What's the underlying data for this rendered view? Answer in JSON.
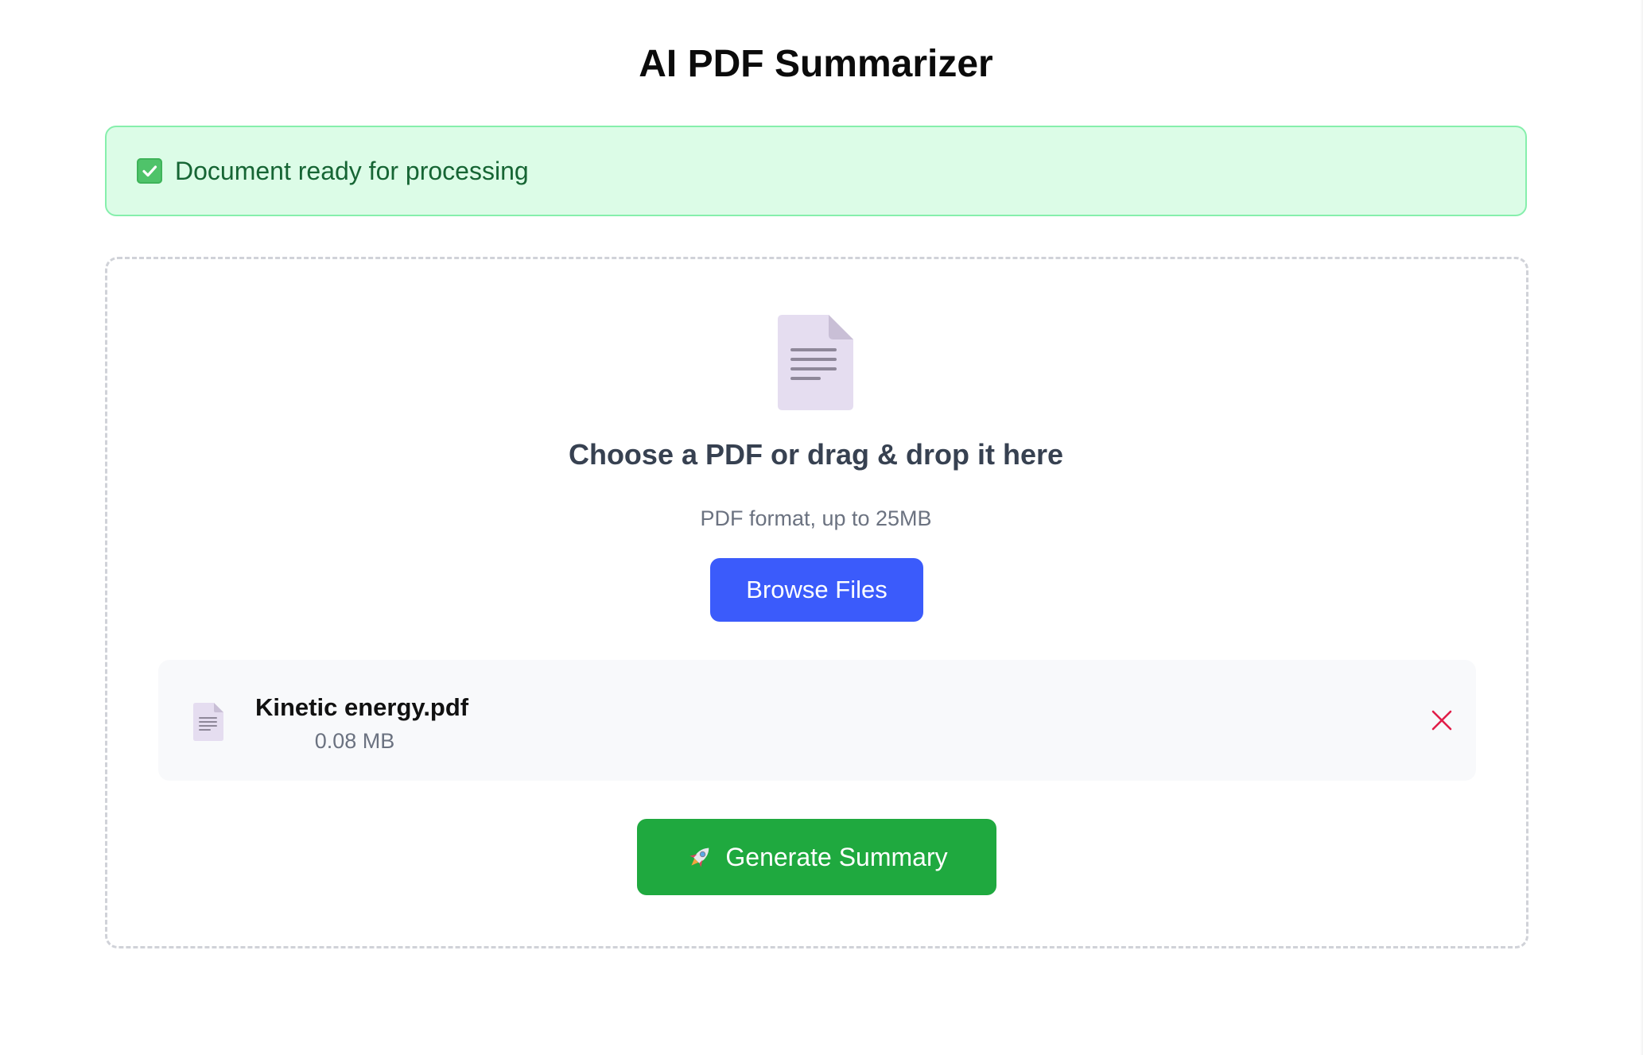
{
  "header": {
    "title": "AI PDF Summarizer"
  },
  "status": {
    "icon": "check-box-icon",
    "message": "Document ready for processing",
    "colors": {
      "background": "#dcfce7",
      "border": "#86efac",
      "text": "#166534"
    }
  },
  "upload": {
    "icon": "document-icon",
    "title": "Choose a PDF or drag & drop it here",
    "subtitle": "PDF format, up to 25MB",
    "browse_label": "Browse Files",
    "browse_color": "#3b5bfb"
  },
  "file": {
    "icon": "document-icon",
    "name": "Kinetic energy.pdf",
    "size": "0.08 MB",
    "remove_icon": "close-icon",
    "remove_color": "#e11d48"
  },
  "action": {
    "icon": "rocket-icon",
    "label": "Generate Summary",
    "color": "#1fa93f"
  }
}
